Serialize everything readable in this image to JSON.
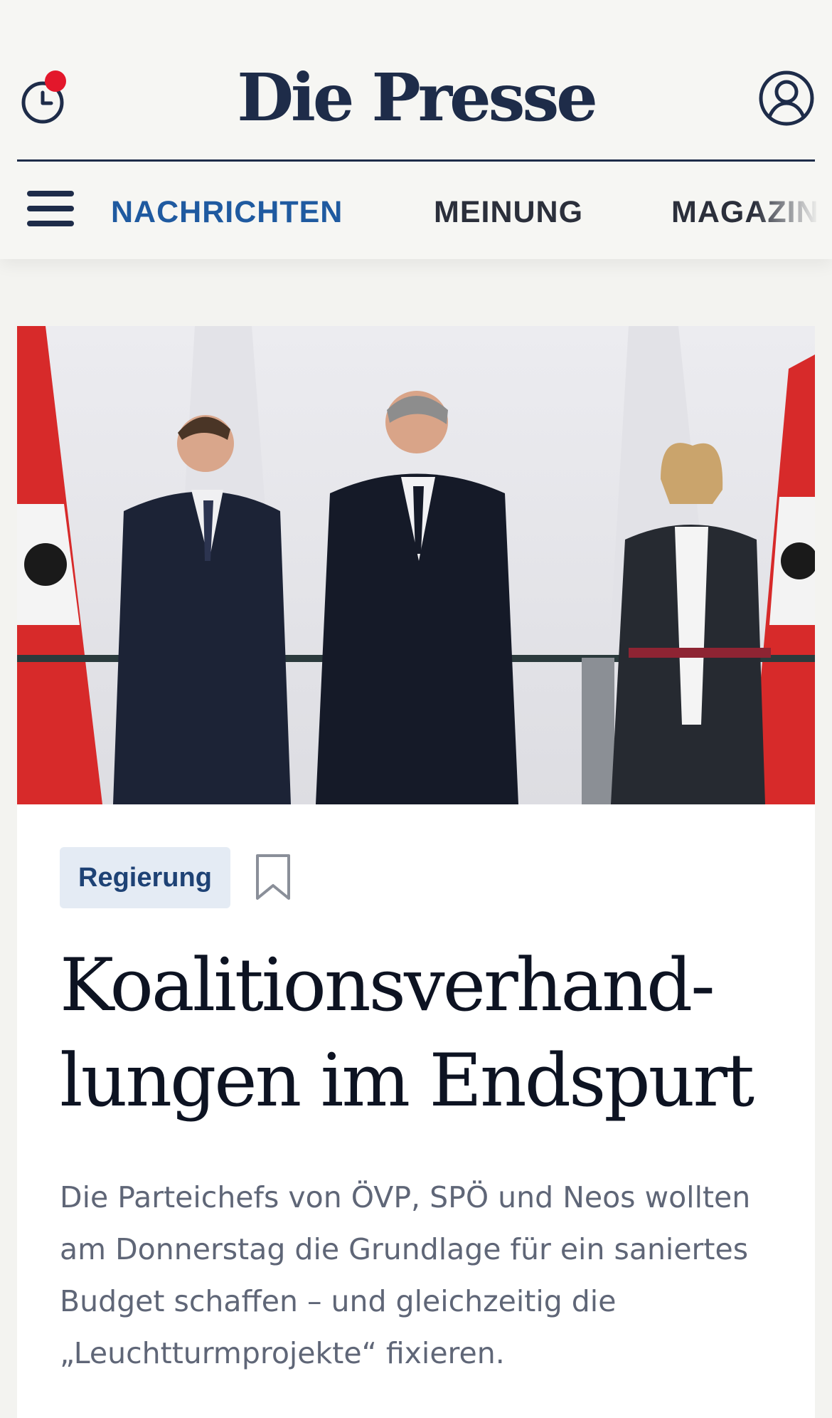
{
  "header": {
    "logo": "Die Presse",
    "notification_dot_color": "#e3172b",
    "brand_color": "#1e2c49",
    "icons": {
      "history": "clock-history-icon",
      "account": "user-account-icon",
      "menu": "hamburger-menu-icon"
    }
  },
  "nav": {
    "active_color": "#1f5aa0",
    "tabs": [
      {
        "label": "NACHRICHTEN",
        "active": true
      },
      {
        "label": "MEINUNG",
        "active": false
      },
      {
        "label": "MAGAZIN",
        "active": false
      }
    ]
  },
  "article": {
    "category": "Regierung",
    "title_line1": "Koalitionsverhand-",
    "title_line2": "lungen im Endspurt",
    "lead": "Die Parteichefs von ÖVP, SPÖ und Neos wollten am Donnerstag die Grundlage für ein saniertes Budget schaffen – und gleichzeitig die „Leuchtturmprojekte“ fixieren.",
    "image_semantic": "press-conference-photo",
    "bookmark_icon": "bookmark-icon"
  }
}
